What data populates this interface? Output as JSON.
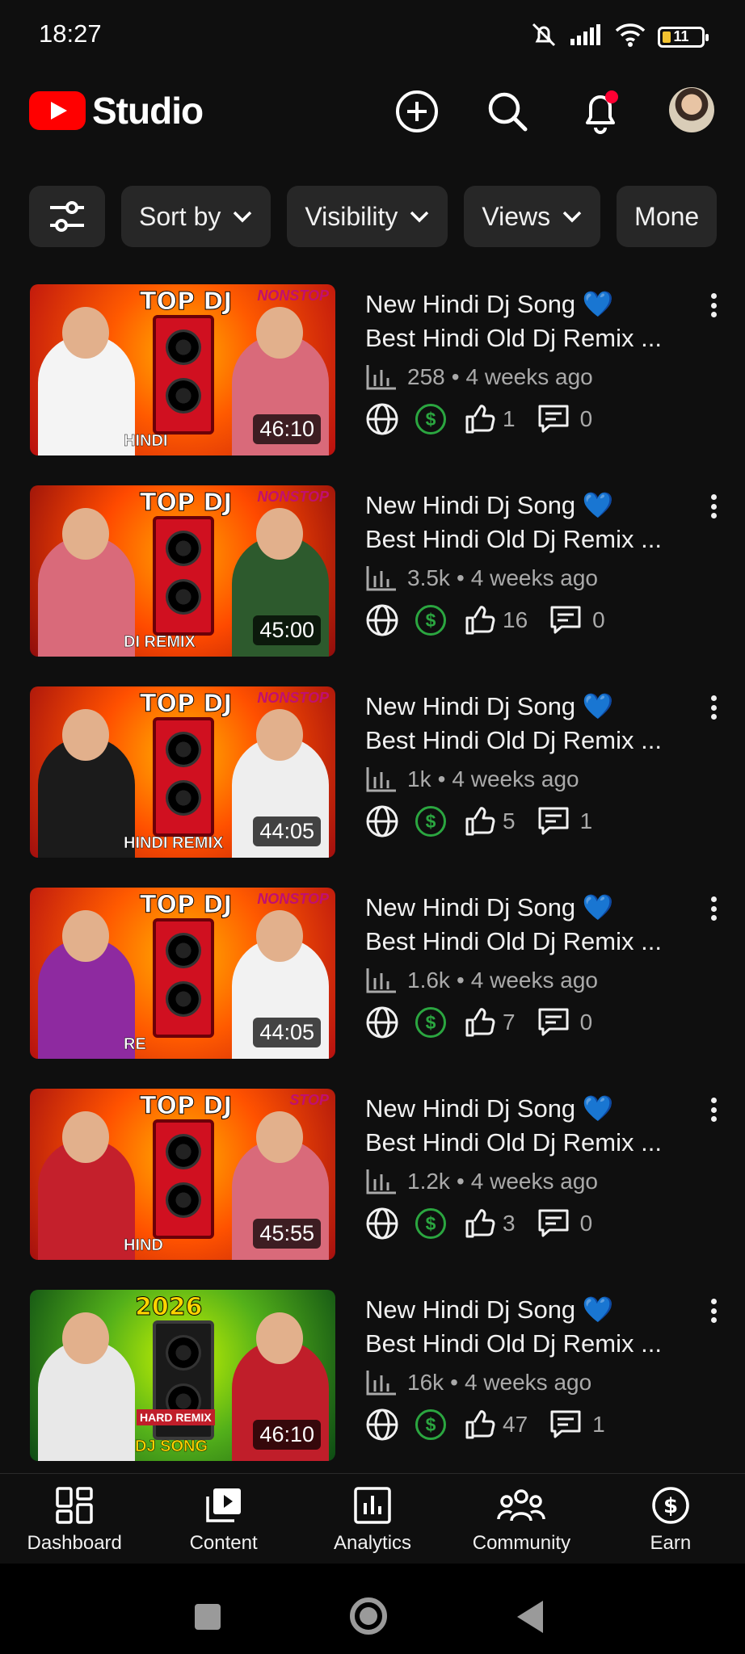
{
  "status": {
    "time": "18:27",
    "battery": "11"
  },
  "header": {
    "brand": "Studio",
    "icons": [
      "create-icon",
      "search-icon",
      "notifications-icon",
      "account-avatar"
    ]
  },
  "filters": [
    {
      "label": "Sort by"
    },
    {
      "label": "Visibility"
    },
    {
      "label": "Views"
    },
    {
      "label": "Mone"
    }
  ],
  "videos": [
    {
      "title_line1": "New Hindi Dj Song 💙",
      "title_line2": "Best Hindi Old Dj Remix ...",
      "views": "258",
      "age": "4 weeks ago",
      "likes": "1",
      "comments": "0",
      "duration": "46:10",
      "thumb_top": "TOP DJ",
      "thumb_corner": "NONSTOP",
      "thumb_bottom": "HINDI"
    },
    {
      "title_line1": "New Hindi Dj Song 💙",
      "title_line2": "Best Hindi Old Dj Remix ...",
      "views": "3.5k",
      "age": "4 weeks ago",
      "likes": "16",
      "comments": "0",
      "duration": "45:00",
      "thumb_top": "TOP DJ",
      "thumb_corner": "NONSTOP",
      "thumb_bottom": "DI REMIX"
    },
    {
      "title_line1": "New Hindi Dj Song 💙",
      "title_line2": "Best Hindi Old Dj Remix ...",
      "views": "1k",
      "age": "4 weeks ago",
      "likes": "5",
      "comments": "1",
      "duration": "44:05",
      "thumb_top": "TOP DJ",
      "thumb_corner": "NONSTOP",
      "thumb_bottom": "HINDI REMIX"
    },
    {
      "title_line1": "New Hindi Dj Song 💙",
      "title_line2": "Best Hindi Old Dj Remix ...",
      "views": "1.6k",
      "age": "4 weeks ago",
      "likes": "7",
      "comments": "0",
      "duration": "44:05",
      "thumb_top": "TOP DJ",
      "thumb_corner": "NONSTOP",
      "thumb_bottom": "RE"
    },
    {
      "title_line1": "New Hindi Dj Song 💙",
      "title_line2": "Best Hindi Old Dj Remix ...",
      "views": "1.2k",
      "age": "4 weeks ago",
      "likes": "3",
      "comments": "0",
      "duration": "45:55",
      "thumb_top": "TOP DJ",
      "thumb_corner": "STOP",
      "thumb_bottom": "HIND"
    },
    {
      "title_line1": "New Hindi Dj Song 💙",
      "title_line2": "Best Hindi Old Dj Remix ...",
      "views": "16k",
      "age": "4 weeks ago",
      "likes": "47",
      "comments": "1",
      "duration": "46:10",
      "thumb_top": "2026",
      "thumb_corner": "HARD REMIX",
      "thumb_bottom": "DJ SONG"
    }
  ],
  "bottom_nav": [
    {
      "label": "Dashboard",
      "icon": "dashboard-icon"
    },
    {
      "label": "Content",
      "icon": "content-icon"
    },
    {
      "label": "Analytics",
      "icon": "analytics-icon"
    },
    {
      "label": "Community",
      "icon": "community-icon"
    },
    {
      "label": "Earn",
      "icon": "earn-icon"
    }
  ],
  "colors": {
    "background": "#0f0f0f",
    "chip": "#272727",
    "brand_red": "#ff0000",
    "monetization_green": "#2ba640",
    "secondary_text": "#aaaaaa"
  }
}
